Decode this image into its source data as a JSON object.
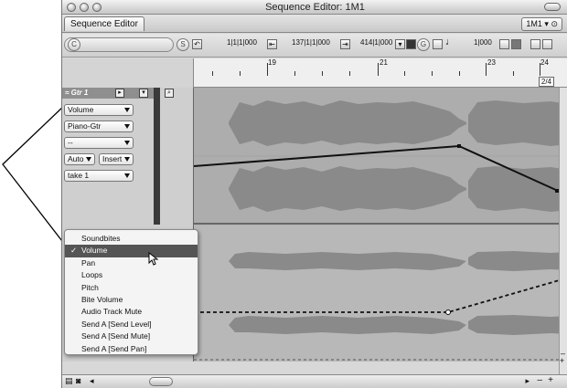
{
  "window": {
    "title": "Sequence Editor: 1M1",
    "tab_label": "Sequence Editor",
    "region_selector": "1M1"
  },
  "toolbar": {
    "catch_label": "C",
    "scroll_label": "S",
    "position_start": "1|1|1|000",
    "position_current": "137|1|1|000",
    "position_end": "414|1|000",
    "grid_label": "G",
    "note_value": "1|000"
  },
  "ruler": {
    "markers": [
      "19",
      "21",
      "23",
      "24"
    ],
    "zoom": "2/4"
  },
  "track": {
    "name": "Gtr 1",
    "param_select": "Volume",
    "instrument_select": "Piano-Gtr",
    "third_select": "--",
    "automation_mode": "Auto",
    "insert_label": "Insert",
    "take_select": "take 1"
  },
  "menu": {
    "items": [
      {
        "label": "Soundbites",
        "checked": false
      },
      {
        "label": "Volume",
        "checked": true
      },
      {
        "label": "Pan",
        "checked": false
      },
      {
        "label": "Loops",
        "checked": false
      },
      {
        "label": "Pitch",
        "checked": false
      },
      {
        "label": "Bite Volume",
        "checked": false
      },
      {
        "label": "Audio Track Mute",
        "checked": false
      },
      {
        "label": "Send A [Send Level]",
        "checked": false
      },
      {
        "label": "Send A [Send Mute]",
        "checked": false
      },
      {
        "label": "Send A [Send Pan]",
        "checked": false
      }
    ],
    "check_glyph": "✓"
  },
  "colors": {
    "menu_highlight": "#555555",
    "waveform": "#8a8a8a",
    "automation_line": "#111111"
  },
  "icons": [
    "record-icon",
    "undo-icon",
    "scissor-icon",
    "note-icon",
    "zoom-icon"
  ]
}
